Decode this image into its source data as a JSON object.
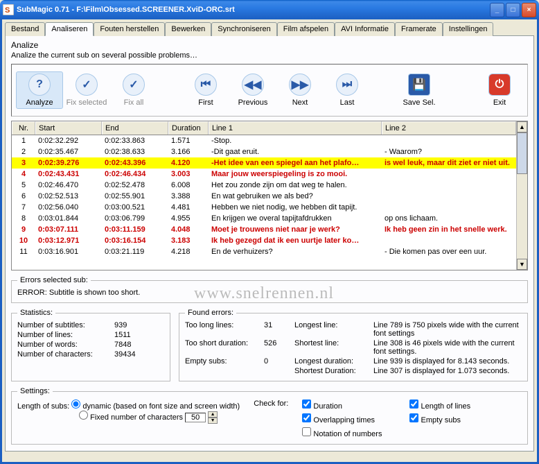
{
  "window": {
    "title": "SubMagic 0.71 - F:\\Film\\Obsessed.SCREENER.XviD-ORC.srt"
  },
  "tabs": [
    "Bestand",
    "Analiseren",
    "Fouten herstellen",
    "Bewerken",
    "Synchroniseren",
    "Film afspelen",
    "AVI Informatie",
    "Framerate",
    "Instellingen"
  ],
  "panel": {
    "title": "Analize",
    "subtitle": "Analize the current sub on several possible problems…"
  },
  "toolbar": {
    "analyze": "Analyze",
    "fixsel": "Fix selected",
    "fixall": "Fix all",
    "first": "First",
    "prev": "Previous",
    "next": "Next",
    "last": "Last",
    "save": "Save Sel.",
    "exit": "Exit"
  },
  "grid": {
    "headers": {
      "nr": "Nr.",
      "start": "Start",
      "end": "End",
      "dur": "Duration",
      "l1": "Line 1",
      "l2": "Line 2"
    },
    "rows": [
      {
        "nr": "1",
        "start": "0:02:32.292",
        "end": "0:02:33.863",
        "dur": "1.571",
        "l1": "-Stop.",
        "l2": "",
        "cls": ""
      },
      {
        "nr": "2",
        "start": "0:02:35.467",
        "end": "0:02:38.633",
        "dur": "3.166",
        "l1": "-Dit gaat eruit.",
        "l2": "- Waarom?",
        "cls": ""
      },
      {
        "nr": "3",
        "start": "0:02:39.276",
        "end": "0:02:43.396",
        "dur": "4.120",
        "l1": "-Het idee van een spiegel aan het plafo…",
        "l2": "is wel leuk, maar dit ziet er niet uit.",
        "cls": "hl-yellow"
      },
      {
        "nr": "4",
        "start": "0:02:43.431",
        "end": "0:02:46.434",
        "dur": "3.003",
        "l1": "Maar jouw weerspiegeling is zo mooi.",
        "l2": "",
        "cls": "hl-red"
      },
      {
        "nr": "5",
        "start": "0:02:46.470",
        "end": "0:02:52.478",
        "dur": "6.008",
        "l1": "Het zou zonde zijn om dat weg te halen.",
        "l2": "",
        "cls": ""
      },
      {
        "nr": "6",
        "start": "0:02:52.513",
        "end": "0:02:55.901",
        "dur": "3.388",
        "l1": "En wat gebruiken we als bed?",
        "l2": "",
        "cls": ""
      },
      {
        "nr": "7",
        "start": "0:02:56.040",
        "end": "0:03:00.521",
        "dur": "4.481",
        "l1": "Hebben we niet nodig, we hebben dit tapijt.",
        "l2": "",
        "cls": ""
      },
      {
        "nr": "8",
        "start": "0:03:01.844",
        "end": "0:03:06.799",
        "dur": "4.955",
        "l1": "En krijgen we overal tapijtafdrukken",
        "l2": "op ons lichaam.",
        "cls": ""
      },
      {
        "nr": "9",
        "start": "0:03:07.111",
        "end": "0:03:11.159",
        "dur": "4.048",
        "l1": "Moet je trouwens niet naar je werk?",
        "l2": "Ik heb geen zin in het snelle werk.",
        "cls": "hl-red"
      },
      {
        "nr": "10",
        "start": "0:03:12.971",
        "end": "0:03:16.154",
        "dur": "3.183",
        "l1": "Ik heb gezegd dat ik een uurtje later ko…",
        "l2": "",
        "cls": "hl-red"
      },
      {
        "nr": "11",
        "start": "0:03:16.901",
        "end": "0:03:21.119",
        "dur": "4.218",
        "l1": "En de verhuizers?",
        "l2": "- Die komen pas over een uur.",
        "cls": ""
      }
    ]
  },
  "error_box": {
    "legend": "Errors selected sub:",
    "msg": "ERROR: Subtitle is shown too short."
  },
  "stats": {
    "legend": "Statistics:",
    "items": [
      [
        "Number of subtitles:",
        "939"
      ],
      [
        "Number of lines:",
        "1511"
      ],
      [
        "Number of words:",
        "7848"
      ],
      [
        "Number of characters:",
        "39434"
      ]
    ]
  },
  "found": {
    "legend": "Found errors:",
    "left": [
      [
        "Too long lines:",
        "31"
      ],
      [
        "Too short duration:",
        "526"
      ],
      [
        "Empty subs:",
        "0"
      ]
    ],
    "right": [
      [
        "Longest line:",
        "Line 789 is 750 pixels wide with the current font settings"
      ],
      [
        "Shortest line:",
        "Line 308 is 46 pixels wide with the current font settings."
      ],
      [
        "Longest duration:",
        "Line 939 is displayed for 8.143 seconds."
      ],
      [
        "Shortest Duration:",
        "Line 307 is displayed for 1.073 seconds."
      ]
    ]
  },
  "settings": {
    "legend": "Settings:",
    "lenlabel": "Length of subs:",
    "dynamic": "dynamic (based on font size and screen width)",
    "fixed": "Fixed number of characters",
    "fixedval": "50",
    "checklabel": "Check for:",
    "checks": {
      "dur": "Duration",
      "len": "Length of lines",
      "over": "Overlapping times",
      "empty": "Empty subs",
      "not": "Notation of numbers"
    }
  },
  "watermark": "www.snelrennen.nl"
}
